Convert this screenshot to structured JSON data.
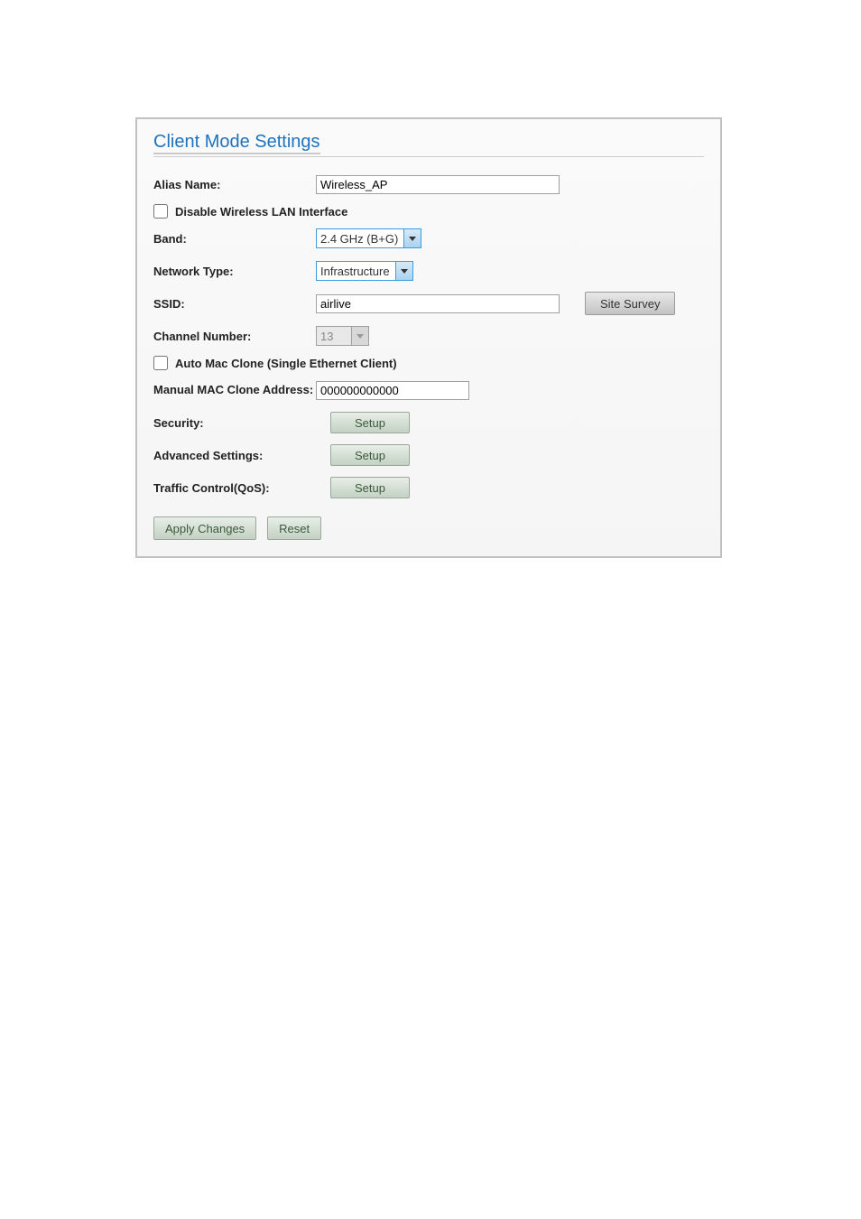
{
  "title": "Client Mode Settings",
  "labels": {
    "alias_name": "Alias Name:",
    "disable_wlan": "Disable Wireless LAN Interface",
    "band": "Band:",
    "network_type": "Network Type:",
    "ssid": "SSID:",
    "channel_number": "Channel Number:",
    "auto_mac_clone": "Auto Mac Clone (Single Ethernet Client)",
    "manual_mac": "Manual MAC Clone Address:",
    "security": "Security:",
    "advanced": "Advanced Settings:",
    "qos": "Traffic Control(QoS):"
  },
  "values": {
    "alias_name": "Wireless_AP",
    "band": "2.4 GHz (B+G)",
    "network_type": "Infrastructure",
    "ssid": "airlive",
    "channel_number": "13",
    "manual_mac": "000000000000"
  },
  "checked": {
    "disable_wlan": false,
    "auto_mac_clone": false
  },
  "buttons": {
    "site_survey": "Site Survey",
    "setup": "Setup",
    "apply": "Apply Changes",
    "reset": "Reset"
  }
}
